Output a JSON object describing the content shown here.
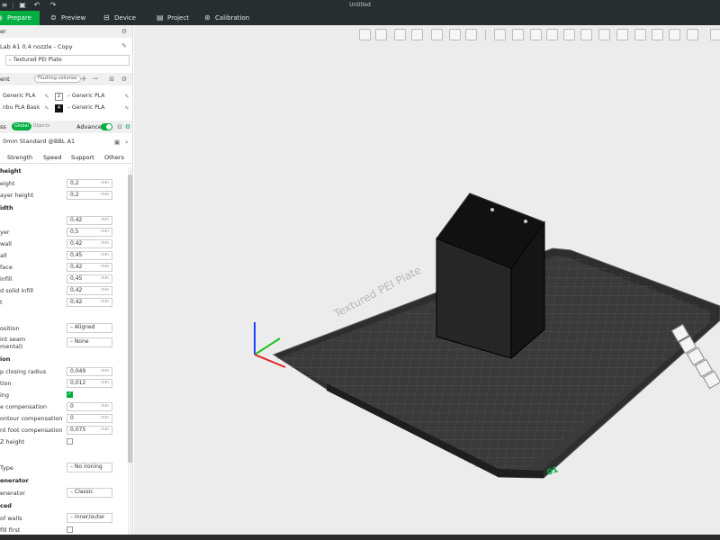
{
  "window": {
    "title": "Untitled"
  },
  "tabs": [
    {
      "label": "Prepare",
      "icon": "prepare-icon"
    },
    {
      "label": "Preview",
      "icon": "preview-icon"
    },
    {
      "label": "Device",
      "icon": "device-icon"
    },
    {
      "label": "Project",
      "icon": "project-icon"
    },
    {
      "label": "Calibration",
      "icon": "calibration-icon"
    }
  ],
  "printer": {
    "section_label": "er",
    "name": "Lab A1 0.4 nozzle - Copy",
    "plate": "Textured PEI Plate"
  },
  "filament": {
    "section_label": "ent",
    "flushing_button": "Flushing volumes",
    "slots": [
      {
        "left_name": "Generic PLA",
        "index": "2",
        "right_name": "Generic PLA"
      },
      {
        "left_name": "nbu PLA Basic",
        "index": "4",
        "right_name": "Generic PLA"
      }
    ]
  },
  "process": {
    "section_label": "ss",
    "toggle_global": "Global",
    "toggle_objects": "Objects",
    "advanced_label": "Advance",
    "preset": "0mm Standard @BBL A1",
    "subtabs": [
      "",
      "Strength",
      "Speed",
      "Support",
      "Others"
    ]
  },
  "settings": {
    "layer_height": {
      "title": "height",
      "rows": [
        {
          "label": "eight",
          "value": "0,2",
          "unit": "mm"
        },
        {
          "label": "ayer height",
          "value": "0,2",
          "unit": "mm"
        }
      ]
    },
    "line_width": {
      "title": "idth",
      "rows": [
        {
          "label": "",
          "value": "0,42",
          "unit": "mm"
        },
        {
          "label": "yer",
          "value": "0,5",
          "unit": "mm"
        },
        {
          "label": "wall",
          "value": "0,42",
          "unit": "mm"
        },
        {
          "label": "all",
          "value": "0,45",
          "unit": "mm"
        },
        {
          "label": "face",
          "value": "0,42",
          "unit": "mm"
        },
        {
          "label": "infill",
          "value": "0,45",
          "unit": "mm"
        },
        {
          "label": "d solid infill",
          "value": "0,42",
          "unit": "mm"
        },
        {
          "label": "t",
          "value": "0,42",
          "unit": "mm"
        }
      ]
    },
    "seam": {
      "rows": [
        {
          "label": "osition",
          "value": "Aligned"
        },
        {
          "label": "int seam\nmental)",
          "value": "None"
        }
      ]
    },
    "precision": {
      "title": "ion",
      "rows": [
        {
          "label": "p closing radius",
          "value": "0,049",
          "unit": "mm"
        },
        {
          "label": "tion",
          "value": "0,012",
          "unit": "mm"
        },
        {
          "label": "ing",
          "checkbox": true
        },
        {
          "label": "e compensation",
          "value": "0",
          "unit": "mm"
        },
        {
          "label": "ontour compensation",
          "value": "0",
          "unit": "mm"
        },
        {
          "label": "nt foot compensation",
          "value": "0,075",
          "unit": "mm"
        },
        {
          "label": "Z height",
          "checkbox": false
        }
      ]
    },
    "ironing": {
      "title": "",
      "label": "Type",
      "value": "No ironing"
    },
    "wall_generator": {
      "title": "enerator",
      "label": "enerator",
      "value": "Classic"
    },
    "advanced": {
      "title": "ced",
      "rows": [
        {
          "label": "of walls",
          "value": "inner/outer"
        },
        {
          "label": "fill first",
          "checkbox": false
        }
      ]
    }
  },
  "viewport": {
    "plate_label": "Textured PEI Plate",
    "plate_number": "01",
    "bg_color": "#ececec",
    "bed_color": "#3a3a3a",
    "model_color": "#202020"
  },
  "colors": {
    "accent": "#00ae42",
    "titlebar": "#262e30"
  }
}
